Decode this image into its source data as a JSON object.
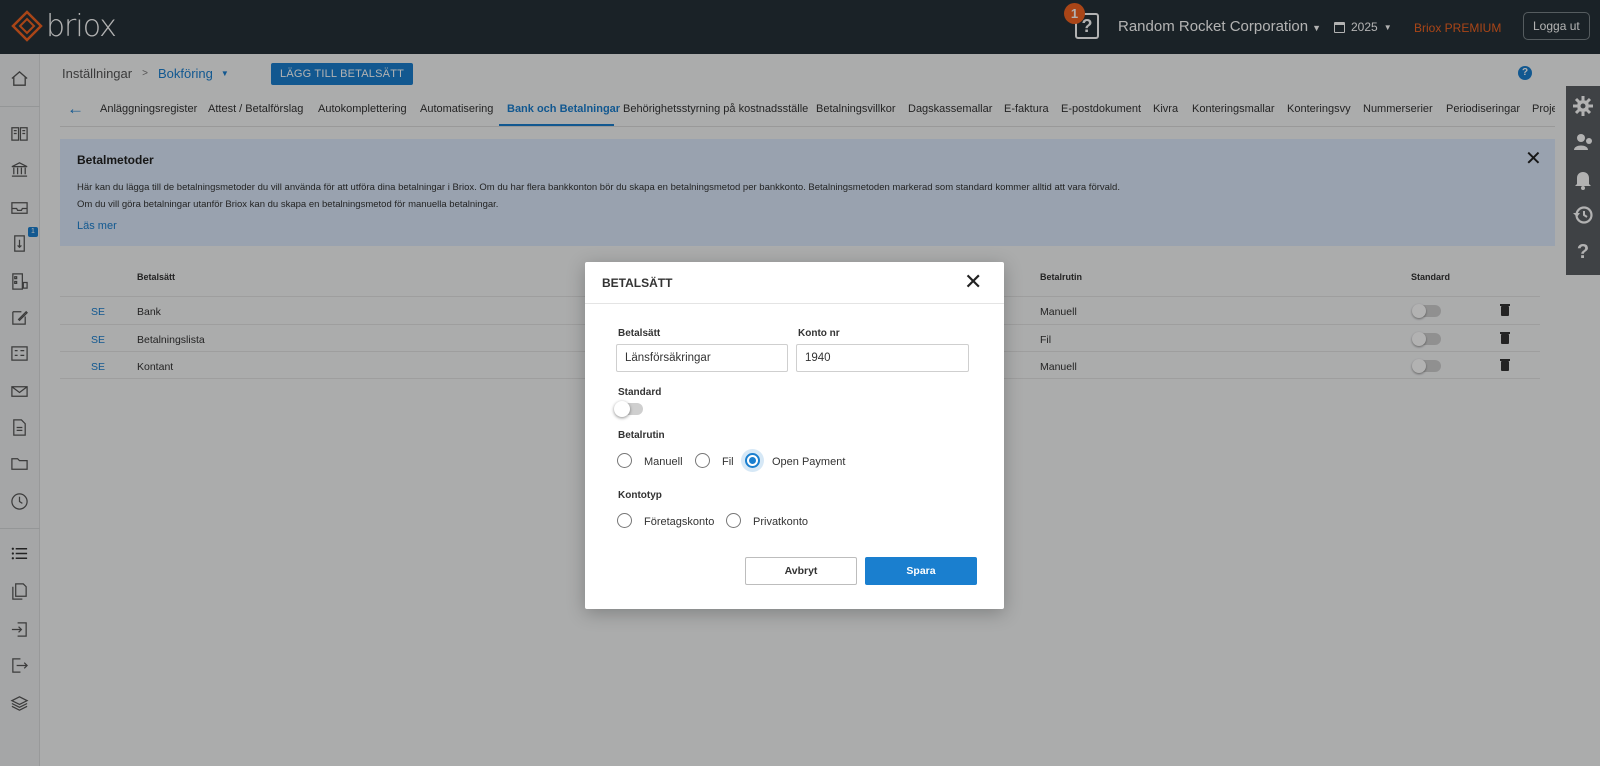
{
  "app": {
    "logo_text": "briox",
    "notification_count": "1",
    "company_name": "Random Rocket Corporation",
    "year": "2025",
    "premium_label": "Briox PREMIUM",
    "logout_label": "Logga ut",
    "help_glyph": "?",
    "accent_color": "#1a7fcf",
    "brand_color": "#f26322"
  },
  "sidebar": {
    "icons": [
      "home-icon",
      "book-icon",
      "bank-icon",
      "inbox-icon",
      "invoice-icon",
      "receipt-icon",
      "edit-icon",
      "checklist-icon",
      "mail-icon",
      "document-icon",
      "folder-icon",
      "clock-icon",
      "list-icon",
      "copy-icon",
      "import-icon",
      "export-icon",
      "layers-icon"
    ],
    "invoice_badge": "1"
  },
  "right_sidebar": {
    "icons": [
      "gear-icon",
      "users-icon",
      "bell-icon",
      "history-icon",
      "question-icon"
    ]
  },
  "breadcrumb": {
    "root": "Inställningar",
    "separator": ">",
    "current": "Bokföring",
    "add_button": "LÄGG TILL BETALSÄTT"
  },
  "tabs": {
    "back_glyph": "←",
    "items": [
      "Anläggningsregister",
      "Attest / Betalförslag",
      "Autokomplettering",
      "Automatisering",
      "Bank och Betalningar",
      "Behörighetsstyrning på kostnadsställe",
      "Betalningsvillkor",
      "Dagskassemallar",
      "E-faktura",
      "E-postdokument",
      "Kivra",
      "Konteringsmallar",
      "Konteringsvy",
      "Nummerserier",
      "Periodiseringar",
      "Proje"
    ],
    "active": "Bank och Betalningar"
  },
  "info": {
    "title": "Betalmetoder",
    "line1": "Här kan du lägga till de betalningsmetoder du vill använda för att utföra dina betalningar i Briox. Om du har flera bankkonton bör du skapa en betalningsmetod per bankkonto. Betalningsmetoden markerad som standard kommer alltid att vara förvald.",
    "line2": "Om du vill göra betalningar utanför Briox kan du skapa en betalningsmetod för manuella betalningar.",
    "link": "Läs mer",
    "close_glyph": "✕"
  },
  "table": {
    "headers": {
      "method": "Betalsätt",
      "routine": "Betalrutin",
      "standard": "Standard"
    },
    "rows": [
      {
        "country": "SE",
        "method": "Bank",
        "routine": "Manuell",
        "standard": false
      },
      {
        "country": "SE",
        "method": "Betalningslista",
        "routine": "Fil",
        "standard": false
      },
      {
        "country": "SE",
        "method": "Kontant",
        "routine": "Manuell",
        "standard": false
      }
    ]
  },
  "modal": {
    "title": "BETALSÄTT",
    "close_glyph": "✕",
    "method_label": "Betalsätt",
    "method_value": "Länsförsäkringar",
    "account_label": "Konto nr",
    "account_value": "1940",
    "standard_label": "Standard",
    "standard_on": false,
    "routine_label": "Betalrutin",
    "routine_options": [
      "Manuell",
      "Fil",
      "Open Payment"
    ],
    "routine_selected": "Open Payment",
    "account_type_label": "Kontotyp",
    "account_type_options": [
      "Företagskonto",
      "Privatkonto"
    ],
    "account_type_selected": "",
    "cancel_label": "Avbryt",
    "save_label": "Spara"
  }
}
